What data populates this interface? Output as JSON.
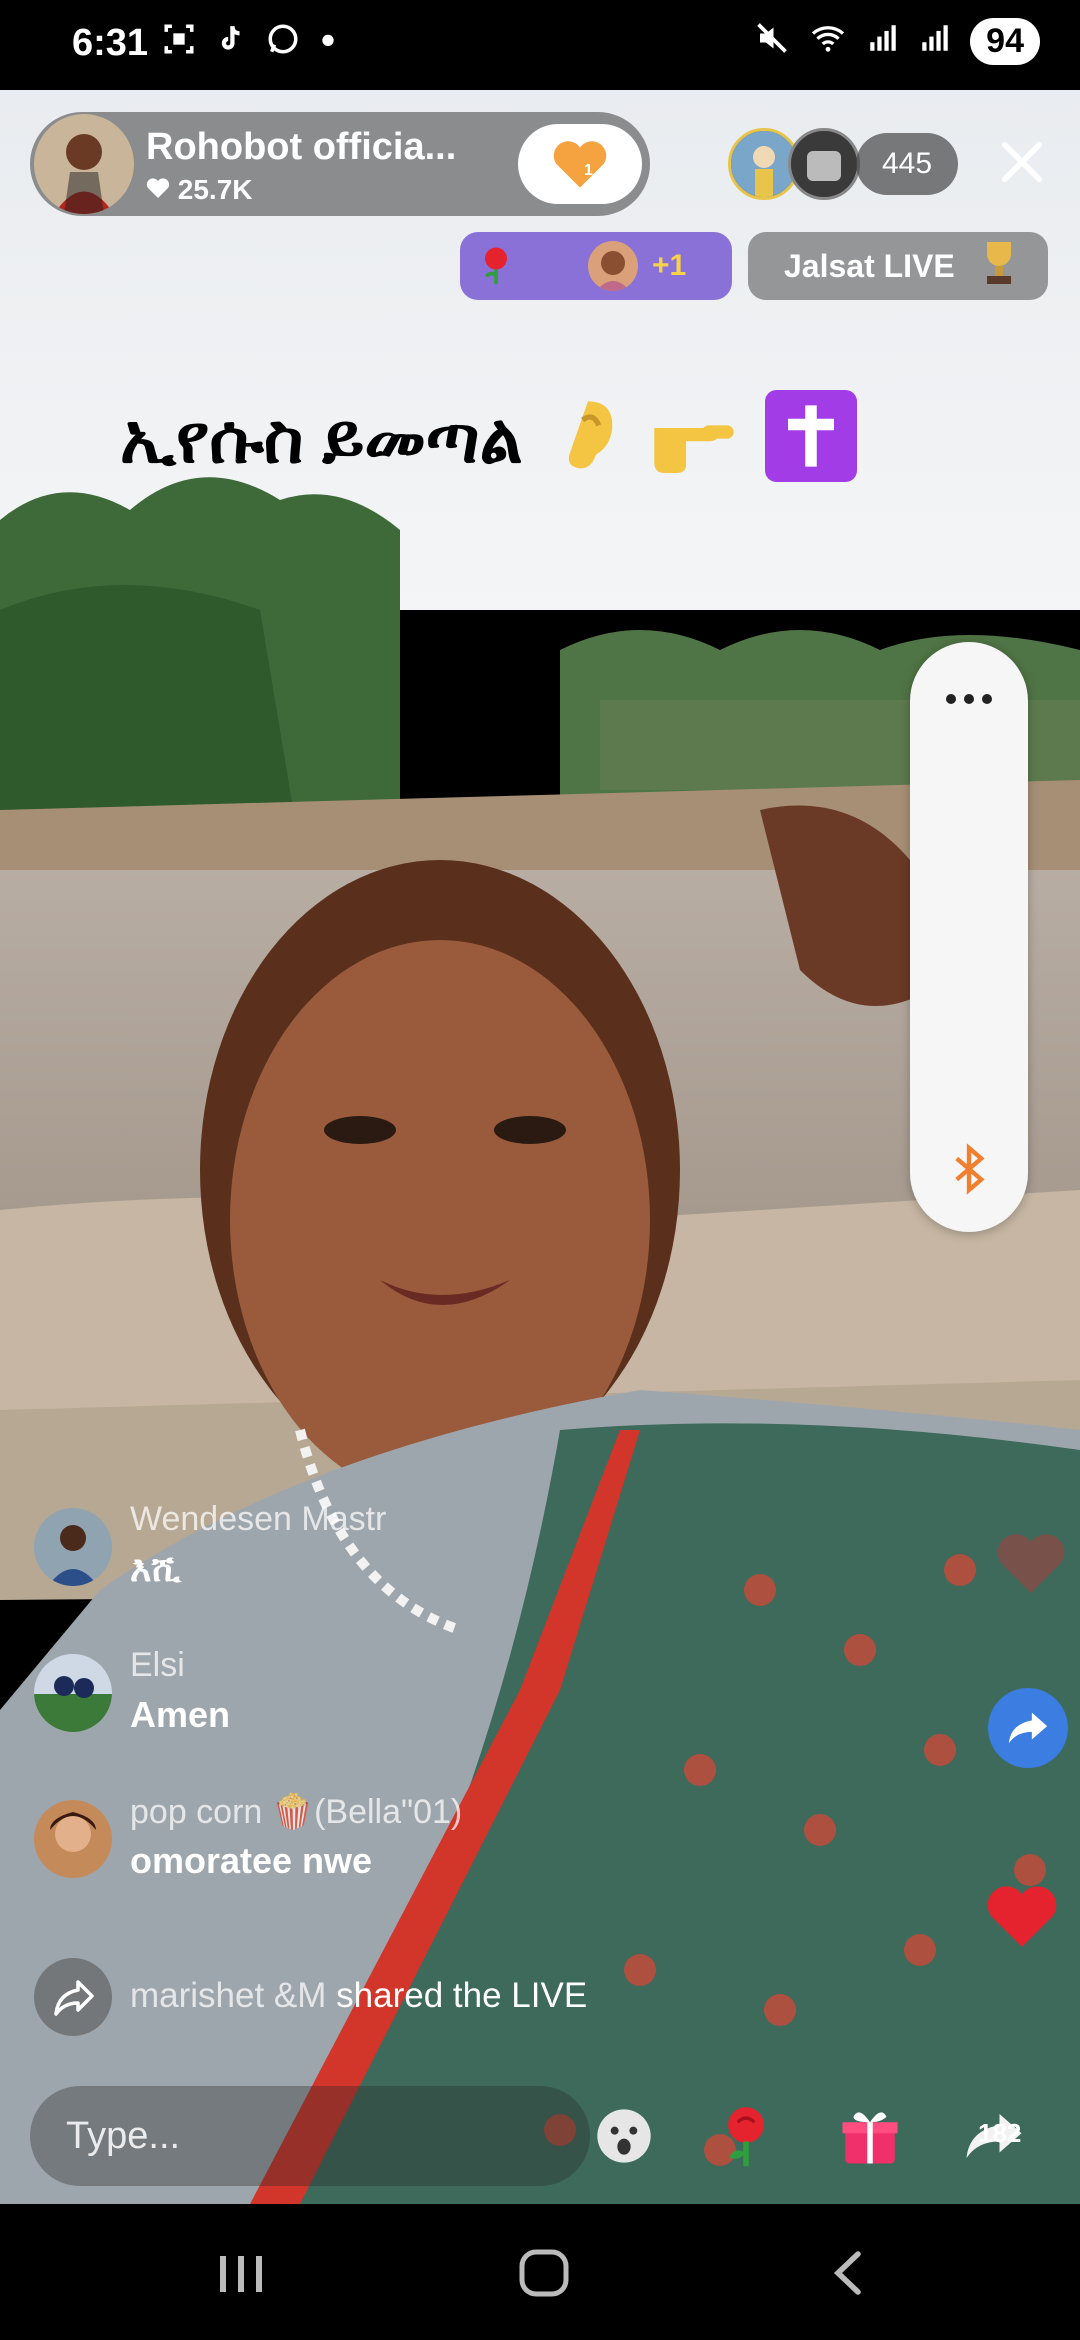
{
  "status_bar": {
    "time": "6:31",
    "battery": "94",
    "left_icons": [
      "screenshot-icon",
      "tiktok-icon",
      "whatsapp-icon",
      "dot-icon"
    ],
    "right_icons": [
      "mute-icon",
      "wifi-icon",
      "signal-icon",
      "signal-icon"
    ]
  },
  "host": {
    "name": "Rohobot officia...",
    "likes": "25.7K",
    "follow_badge": "1"
  },
  "viewers": {
    "count": "445"
  },
  "gift_banner": {
    "extra": "+1"
  },
  "jalsat": {
    "label": "Jalsat LIVE"
  },
  "stream": {
    "title": "ኢየሱስ ይመጣል"
  },
  "comments": [
    {
      "user": "Wendesen Mastr",
      "text": "እሺ"
    },
    {
      "user": "Elsi",
      "text": "Amen"
    },
    {
      "user": "pop corn 🍿(Bella\"01)",
      "text": "omoratee nwe"
    }
  ],
  "share_event": {
    "user": "marishet &M",
    "action": "shared the LIVE"
  },
  "composer": {
    "placeholder": "Type..."
  },
  "share": {
    "count": "182"
  },
  "colors": {
    "accent_purple": "#7b5cd6",
    "heart_red": "#e5232e",
    "share_blue": "#3b7de0",
    "gift_pink": "#f0306a"
  }
}
